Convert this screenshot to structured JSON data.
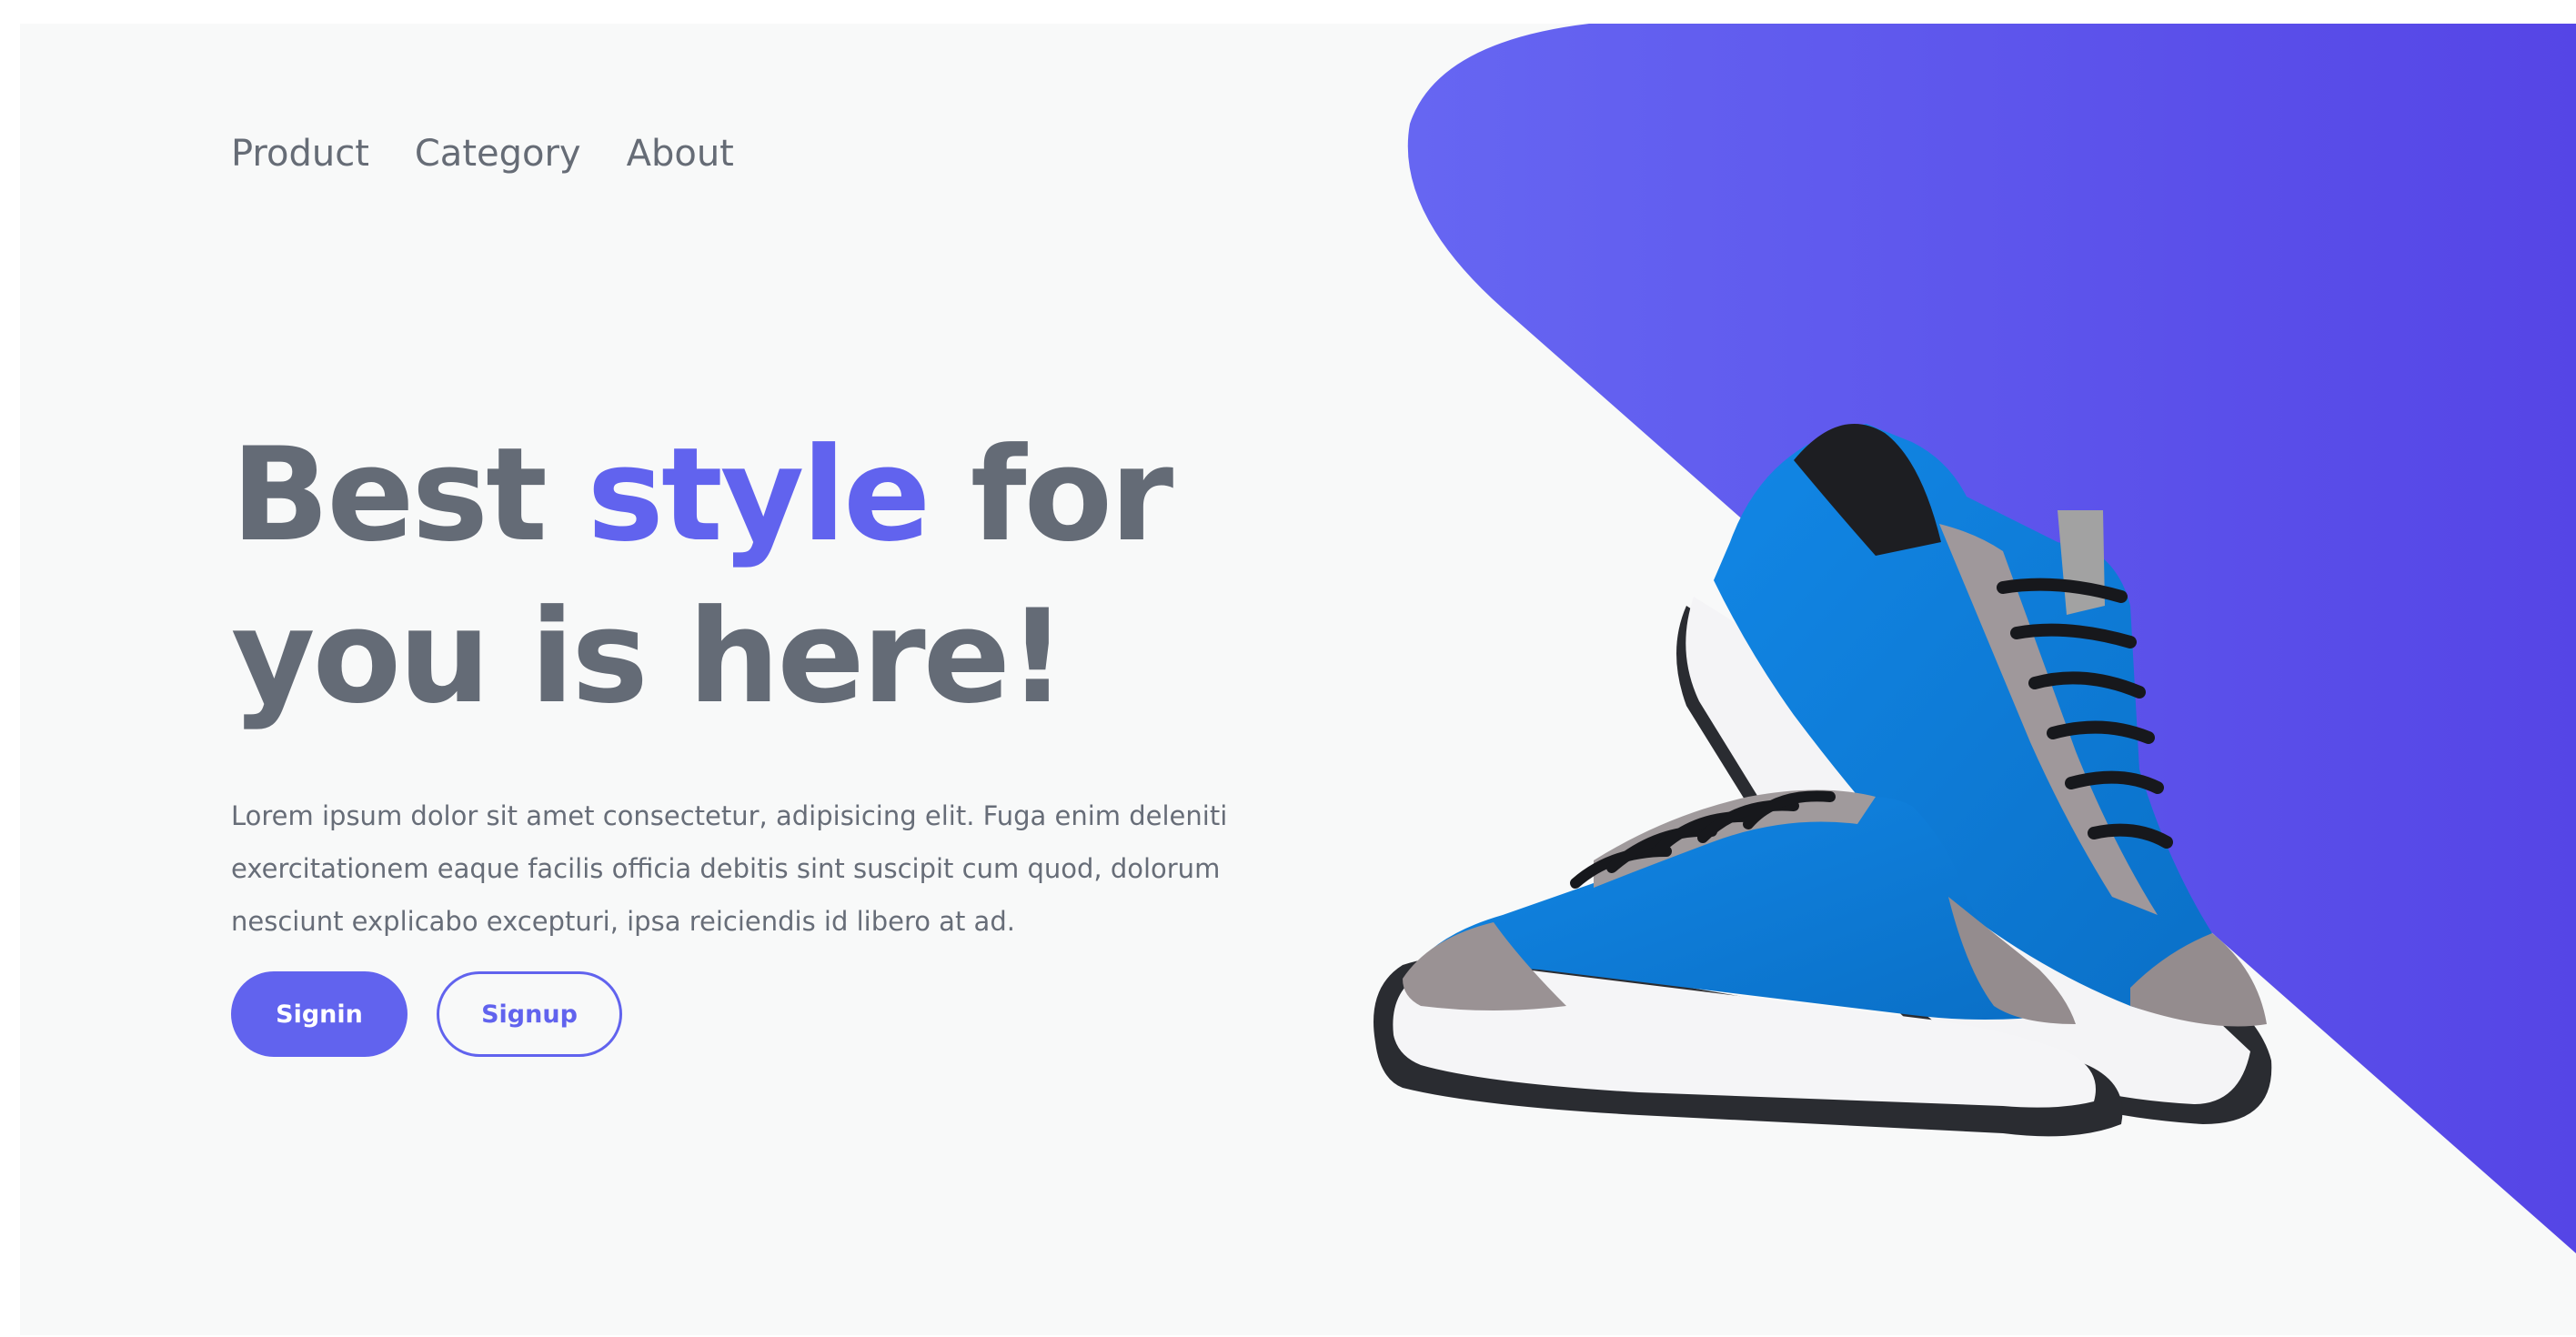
{
  "nav": {
    "items": [
      {
        "label": "Product"
      },
      {
        "label": "Category"
      },
      {
        "label": "About"
      }
    ]
  },
  "hero": {
    "headline_part1": "Best ",
    "headline_accent": "style",
    "headline_part2": " for",
    "headline_line2": "you is here!",
    "description": "Lorem ipsum dolor sit amet consectetur, adipisicing elit. Fuga enim deleniti exercitationem eaque facilis officia debitis sint suscipit cum quod, dolorum nesciunt explicabo excepturi, ipsa reiciendis id libero at ad.",
    "signin_label": "Signin",
    "signup_label": "Signup"
  },
  "colors": {
    "accent": "#6163ee",
    "heading": "#646b76",
    "background": "#f8f9f9",
    "shoe_blue": "#0a7ad6"
  },
  "icons": {
    "hero_image": "blue-sneakers-pair"
  }
}
